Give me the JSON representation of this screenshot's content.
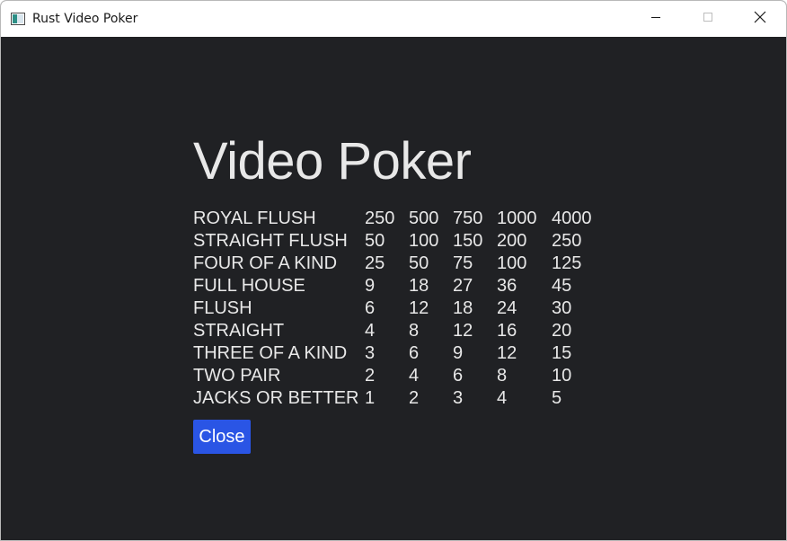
{
  "window": {
    "title": "Rust Video Poker",
    "controls": {
      "minimize_icon": "minimize-icon",
      "maximize_icon": "maximize-icon",
      "close_icon": "close-icon"
    }
  },
  "main": {
    "heading": "Video Poker",
    "paytable": [
      {
        "hand": "ROYAL FLUSH",
        "payouts": [
          "250",
          "500",
          "750",
          "1000",
          "4000"
        ]
      },
      {
        "hand": "STRAIGHT FLUSH",
        "payouts": [
          "50",
          "100",
          "150",
          "200",
          "250"
        ]
      },
      {
        "hand": "FOUR OF A KIND",
        "payouts": [
          "25",
          "50",
          "75",
          "100",
          "125"
        ]
      },
      {
        "hand": "FULL HOUSE",
        "payouts": [
          "9",
          "18",
          "27",
          "36",
          "45"
        ]
      },
      {
        "hand": "FLUSH",
        "payouts": [
          "6",
          "12",
          "18",
          "24",
          "30"
        ]
      },
      {
        "hand": "STRAIGHT",
        "payouts": [
          "4",
          "8",
          "12",
          "16",
          "20"
        ]
      },
      {
        "hand": "THREE OF A KIND",
        "payouts": [
          "3",
          "6",
          "9",
          "12",
          "15"
        ]
      },
      {
        "hand": "TWO PAIR",
        "payouts": [
          "2",
          "4",
          "6",
          "8",
          "10"
        ]
      },
      {
        "hand": "JACKS OR BETTER",
        "payouts": [
          "1",
          "2",
          "3",
          "4",
          "5"
        ]
      }
    ],
    "close_button_label": "Close"
  },
  "colors": {
    "background": "#202124",
    "text": "#e8e8e8",
    "button": "#2a55e5",
    "titlebar": "#ffffff"
  }
}
